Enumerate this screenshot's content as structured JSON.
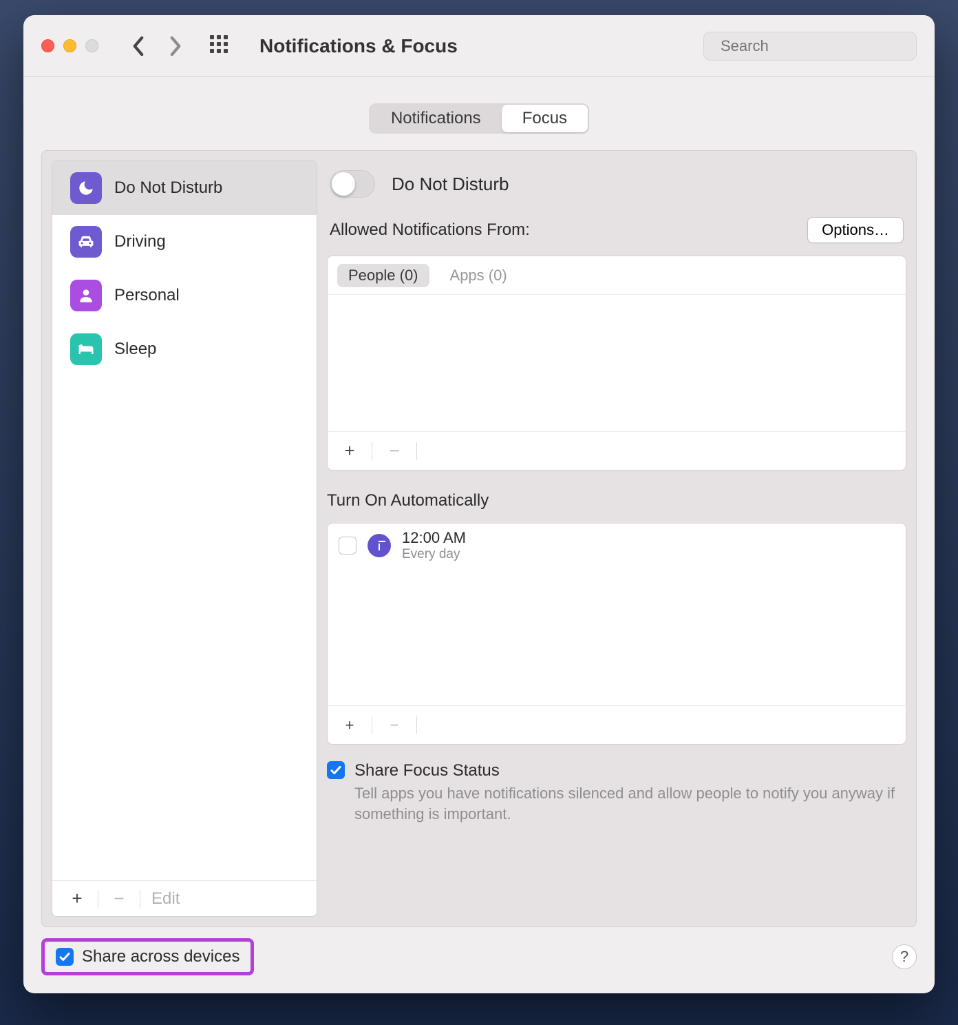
{
  "window": {
    "title": "Notifications & Focus",
    "search_placeholder": "Search"
  },
  "tabs": {
    "notifications": "Notifications",
    "focus": "Focus",
    "active": "focus"
  },
  "focus_modes": [
    {
      "id": "dnd",
      "label": "Do Not Disturb",
      "color": "#6f5acf",
      "icon": "moon"
    },
    {
      "id": "driving",
      "label": "Driving",
      "color": "#6f5acf",
      "icon": "car"
    },
    {
      "id": "personal",
      "label": "Personal",
      "color": "#a94ee0",
      "icon": "person"
    },
    {
      "id": "sleep",
      "label": "Sleep",
      "color": "#2ac4ae",
      "icon": "bed"
    }
  ],
  "sidebar_footer": {
    "edit": "Edit"
  },
  "detail": {
    "title": "Do Not Disturb",
    "allowed_label": "Allowed Notifications From:",
    "options_btn": "Options…",
    "filter_tabs": {
      "people": "People (0)",
      "apps": "Apps (0)"
    },
    "auto_label": "Turn On Automatically",
    "auto_items": [
      {
        "time": "12:00 AM",
        "repeat": "Every day",
        "enabled": false
      }
    ],
    "share_status": {
      "title": "Share Focus Status",
      "desc": "Tell apps you have notifications silenced and allow people to notify you anyway if something is important.",
      "checked": true
    }
  },
  "share_devices": {
    "label": "Share across devices",
    "checked": true
  },
  "help": "?"
}
